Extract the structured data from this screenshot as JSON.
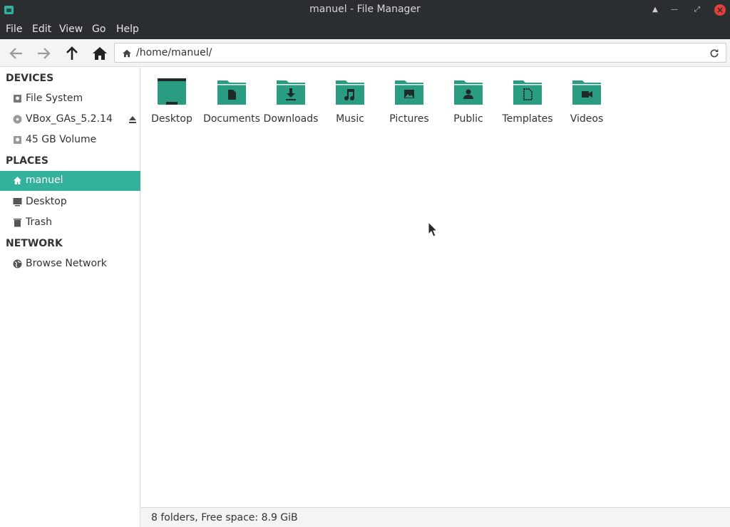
{
  "window": {
    "title": "manuel - File Manager"
  },
  "menu": [
    "File",
    "Edit",
    "View",
    "Go",
    "Help"
  ],
  "toolbar": {
    "location_path": "/home/manuel/"
  },
  "sidebar": {
    "devices_heading": "DEVICES",
    "devices": [
      {
        "label": "File System",
        "icon": "drive-icon"
      },
      {
        "label": "VBox_GAs_5.2.14",
        "icon": "optical-disc-icon"
      },
      {
        "label": "45 GB Volume",
        "icon": "drive-icon"
      }
    ],
    "places_heading": "PLACES",
    "places": [
      {
        "label": "manuel",
        "icon": "home-icon",
        "selected": true
      },
      {
        "label": "Desktop",
        "icon": "desktop-icon"
      },
      {
        "label": "Trash",
        "icon": "trash-icon"
      }
    ],
    "network_heading": "NETWORK",
    "network": [
      {
        "label": "Browse Network",
        "icon": "network-icon"
      }
    ]
  },
  "folders": [
    {
      "label": "Desktop",
      "icon": "desktop-folder-icon"
    },
    {
      "label": "Documents",
      "icon": "documents-folder-icon"
    },
    {
      "label": "Downloads",
      "icon": "downloads-folder-icon"
    },
    {
      "label": "Music",
      "icon": "music-folder-icon"
    },
    {
      "label": "Pictures",
      "icon": "pictures-folder-icon"
    },
    {
      "label": "Public",
      "icon": "public-folder-icon"
    },
    {
      "label": "Templates",
      "icon": "templates-folder-icon"
    },
    {
      "label": "Videos",
      "icon": "videos-folder-icon"
    }
  ],
  "status": {
    "text": "8 folders, Free space: 8.9 GiB"
  },
  "colors": {
    "accent": "#33b19b",
    "folder": "#2a9c82",
    "titlebar": "#2b2e31",
    "close": "#e0413a"
  }
}
